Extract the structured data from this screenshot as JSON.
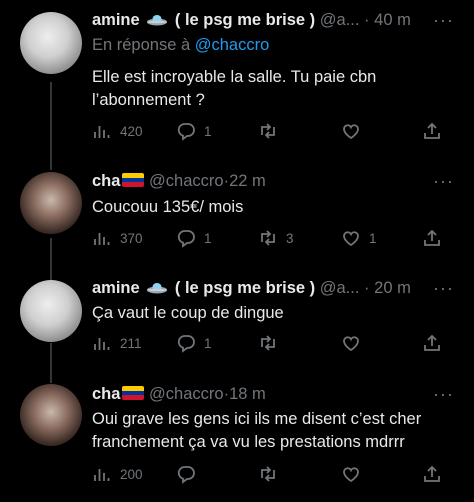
{
  "tweets": [
    {
      "name": "amine",
      "name_suffix": "( le psg me brise )",
      "handle": "@a...",
      "time": "40 m",
      "reply_prefix": "En réponse à",
      "reply_mention": "@chaccro",
      "text_line1": "Elle est incroyable la salle. Tu paie cbn",
      "text_line2": "l’abonnement ?",
      "views": "420",
      "replies": "1",
      "retweets": "",
      "likes": ""
    },
    {
      "name": "cha",
      "handle": "@chaccro",
      "time": "22 m",
      "text_line1": "Coucouu 135€/ mois",
      "views": "370",
      "replies": "1",
      "retweets": "3",
      "likes": "1"
    },
    {
      "name": "amine",
      "name_suffix": "( le psg me brise )",
      "handle": "@a...",
      "time": "20 m",
      "text_line1": "Ça vaut le coup de dingue",
      "views": "211",
      "replies": "1",
      "retweets": "",
      "likes": ""
    },
    {
      "name": "cha",
      "handle": "@chaccro",
      "time": "18 m",
      "text_line1": "Oui grave les gens ici ils me disent c’est cher",
      "text_line2": "franchement ça va vu les prestations mdrrr",
      "views": "200",
      "replies": "",
      "retweets": "",
      "likes": ""
    }
  ],
  "separator": "·",
  "more_glyph": "···",
  "colors": {
    "background": "#000000",
    "text": "#e7e9ea",
    "muted": "#71767b",
    "link": "#1d9bf0",
    "thread_line": "#333639"
  },
  "icons": [
    "ufo-emoji-icon",
    "venezuela-flag-icon",
    "views-icon",
    "reply-icon",
    "retweet-icon",
    "like-icon",
    "share-icon",
    "more-icon"
  ]
}
